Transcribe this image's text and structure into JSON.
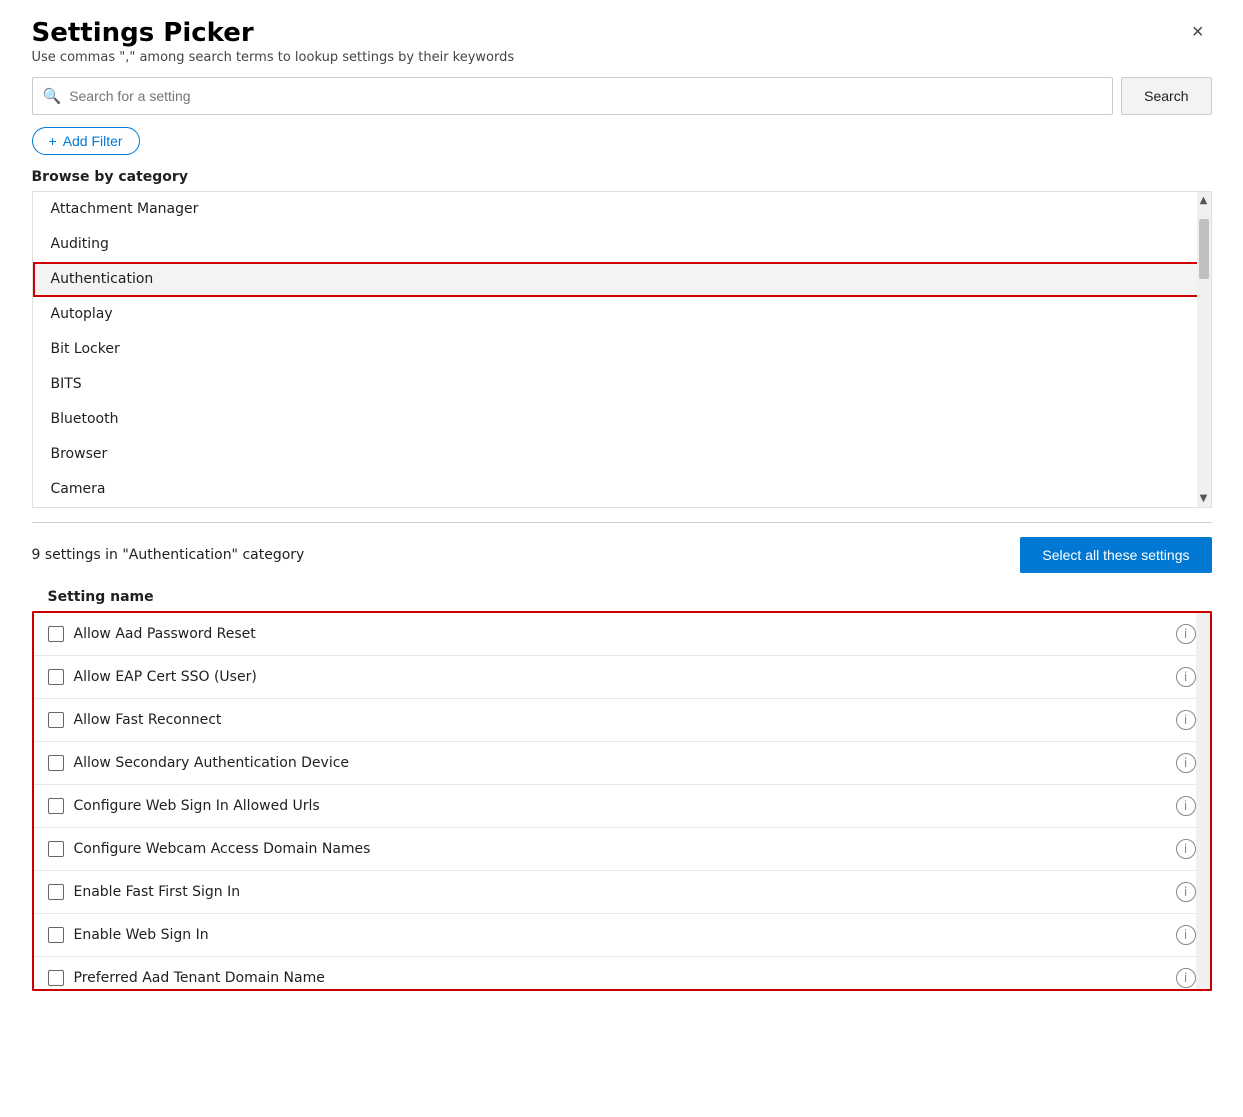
{
  "dialog": {
    "title": "Settings Picker",
    "subtitle": "Use commas \",\" among search terms to lookup settings by their keywords",
    "close_label": "×"
  },
  "search": {
    "placeholder": "Search for a setting",
    "button_label": "Search"
  },
  "add_filter": {
    "label": "Add Filter",
    "plus_icon": "+"
  },
  "browse": {
    "section_title": "Browse by category",
    "categories": [
      {
        "label": "Attachment Manager",
        "selected": false
      },
      {
        "label": "Auditing",
        "selected": false
      },
      {
        "label": "Authentication",
        "selected": true
      },
      {
        "label": "Autoplay",
        "selected": false
      },
      {
        "label": "Bit Locker",
        "selected": false
      },
      {
        "label": "BITS",
        "selected": false
      },
      {
        "label": "Bluetooth",
        "selected": false
      },
      {
        "label": "Browser",
        "selected": false
      },
      {
        "label": "Camera",
        "selected": false
      }
    ]
  },
  "results": {
    "count_text": "9 settings in \"Authentication\" category",
    "select_all_label": "Select all these settings",
    "table_header": "Setting name",
    "settings": [
      {
        "label": "Allow Aad Password Reset",
        "checked": false
      },
      {
        "label": "Allow EAP Cert SSO (User)",
        "checked": false
      },
      {
        "label": "Allow Fast Reconnect",
        "checked": false
      },
      {
        "label": "Allow Secondary Authentication Device",
        "checked": false
      },
      {
        "label": "Configure Web Sign In Allowed Urls",
        "checked": false
      },
      {
        "label": "Configure Webcam Access Domain Names",
        "checked": false
      },
      {
        "label": "Enable Fast First Sign In",
        "checked": false
      },
      {
        "label": "Enable Web Sign In",
        "checked": false
      },
      {
        "label": "Preferred Aad Tenant Domain Name",
        "checked": false
      }
    ]
  }
}
